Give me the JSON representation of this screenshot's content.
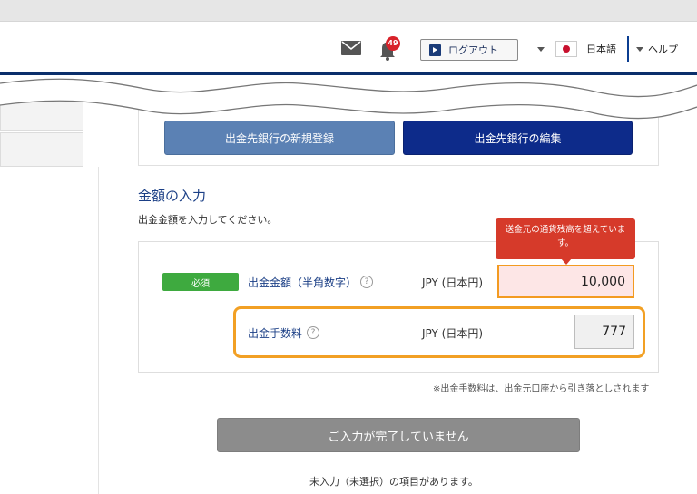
{
  "header": {
    "logout_label": "ログアウト",
    "notification_count": "49",
    "language_label": "日本語",
    "help_label": "ヘルプ"
  },
  "bank_buttons": {
    "new_label": "出金先銀行の新規登録",
    "edit_label": "出金先銀行の編集"
  },
  "amount_section": {
    "title": "金額の入力",
    "description": "出金金額を入力してください。",
    "required_badge": "必須",
    "amount_label": "出金金額（半角数字）",
    "amount_currency": "JPY (日本円)",
    "amount_value": "10,000",
    "error_tooltip": "送金元の通貨残高を超えています。",
    "fee_label": "出金手数料",
    "fee_currency": "JPY (日本円)",
    "fee_value": "777",
    "fee_note": "※出金手数料は、出金元口座から引き落としされます",
    "help_glyph": "?"
  },
  "submit": {
    "label": "ご入力が完了していません",
    "warning": "未入力（未選択）の項目があります。"
  },
  "colors": {
    "header_rule": "#0b2f6b",
    "edit_button": "#0d2b8a",
    "new_button": "#5b81b4",
    "required_badge": "#3eaa3f",
    "error": "#d63a2a",
    "highlight": "#f2a024"
  }
}
